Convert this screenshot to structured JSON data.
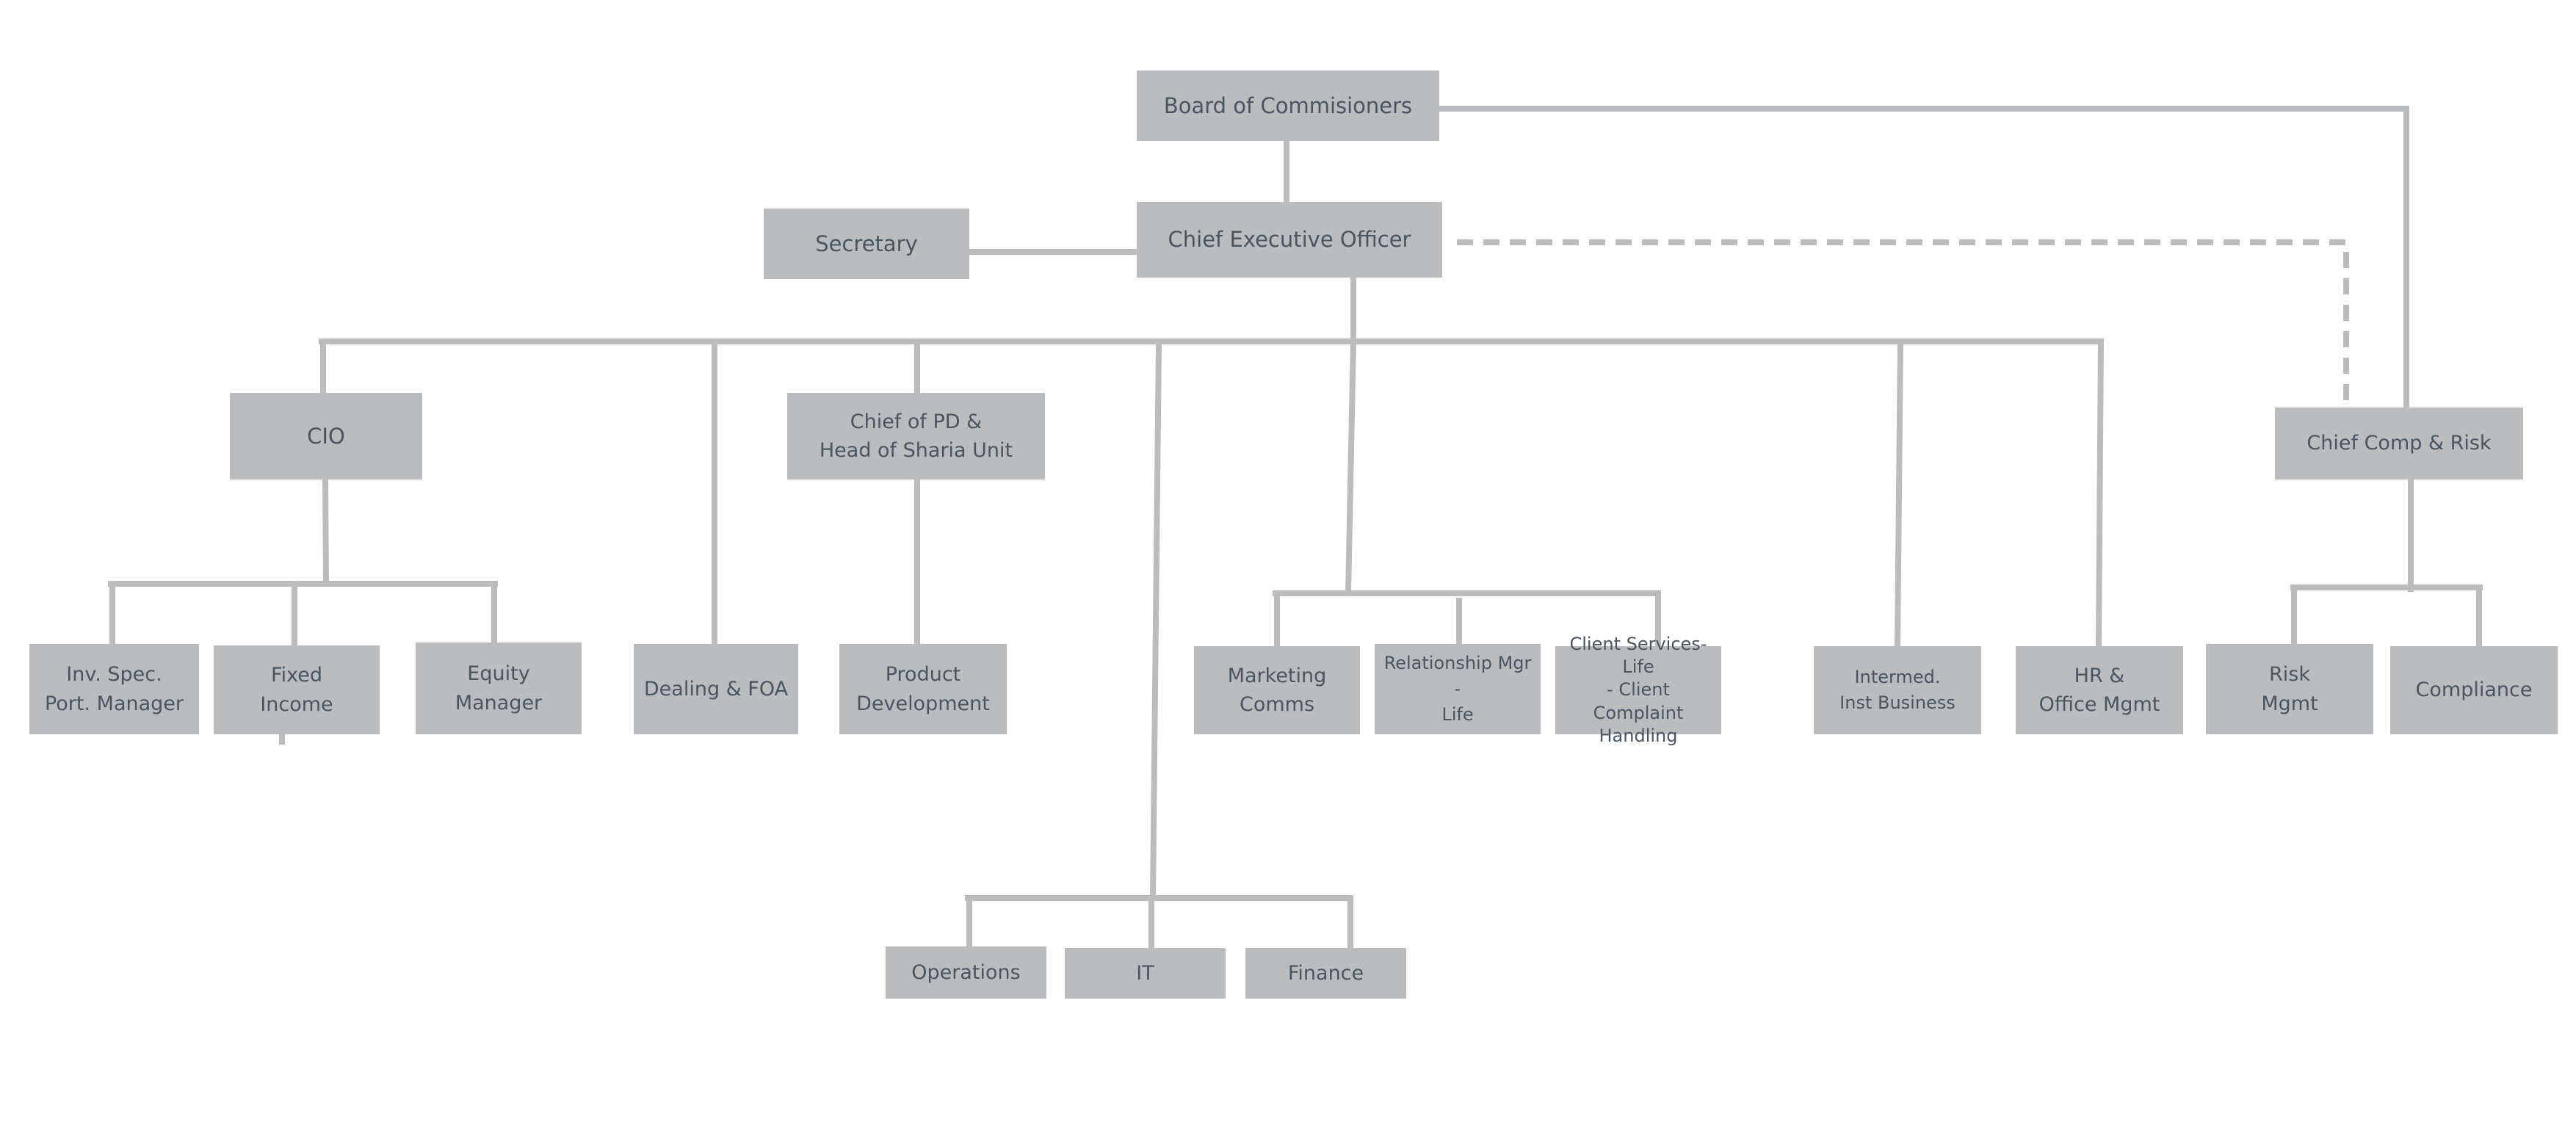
{
  "chart": {
    "type": "org-chart",
    "colors": {
      "box_fill": "#bbbcbe",
      "text": "#4a5560",
      "connector": "#bbbcbe",
      "background": "#ffffff"
    },
    "nodes": {
      "board": {
        "label": "Board of Commisioners"
      },
      "ceo": {
        "label": "Chief Executive Officer"
      },
      "secretary": {
        "label": "Secretary"
      },
      "cio": {
        "label": "CIO"
      },
      "chief_pd": {
        "label": "Chief of PD &\nHead of Sharia Unit"
      },
      "chief_comp_risk": {
        "label": "Chief Comp & Risk"
      },
      "inv_spec": {
        "label": "Inv. Spec.\nPort. Manager"
      },
      "fixed_income": {
        "label": "Fixed\nIncome"
      },
      "equity": {
        "label": "Equity\nManager"
      },
      "dealing": {
        "label": "Dealing & FOA"
      },
      "product_dev": {
        "label": "Product\nDevelopment"
      },
      "marketing": {
        "label": "Marketing\nComms"
      },
      "relationship": {
        "label": "Relationship Mgr -\nLife"
      },
      "client_services": {
        "label": "Client Services-Life\n- Client Complaint\nHandling"
      },
      "intermed": {
        "label": "Intermed.\nInst Business"
      },
      "hr": {
        "label": "HR &\nOffice Mgmt"
      },
      "risk": {
        "label": "Risk\nMgmt"
      },
      "compliance": {
        "label": "Compliance"
      },
      "operations": {
        "label": "Operations"
      },
      "it": {
        "label": "IT"
      },
      "finance": {
        "label": "Finance"
      }
    },
    "edges": [
      {
        "from": "board",
        "to": "ceo",
        "style": "solid"
      },
      {
        "from": "board",
        "to": "chief_comp_risk",
        "style": "solid"
      },
      {
        "from": "ceo",
        "to": "chief_comp_risk",
        "style": "dashed"
      },
      {
        "from": "ceo",
        "to": "secretary",
        "style": "solid"
      },
      {
        "from": "ceo",
        "to": "cio",
        "style": "solid"
      },
      {
        "from": "ceo",
        "to": "dealing",
        "style": "solid"
      },
      {
        "from": "ceo",
        "to": "chief_pd",
        "style": "solid"
      },
      {
        "from": "ceo",
        "to": "operations",
        "style": "solid"
      },
      {
        "from": "ceo",
        "to": "it",
        "style": "solid"
      },
      {
        "from": "ceo",
        "to": "finance",
        "style": "solid"
      },
      {
        "from": "ceo",
        "to": "marketing",
        "style": "solid"
      },
      {
        "from": "ceo",
        "to": "relationship",
        "style": "solid"
      },
      {
        "from": "ceo",
        "to": "client_services",
        "style": "solid"
      },
      {
        "from": "ceo",
        "to": "intermed",
        "style": "solid"
      },
      {
        "from": "ceo",
        "to": "hr",
        "style": "solid"
      },
      {
        "from": "cio",
        "to": "inv_spec",
        "style": "solid"
      },
      {
        "from": "cio",
        "to": "fixed_income",
        "style": "solid"
      },
      {
        "from": "cio",
        "to": "equity",
        "style": "solid"
      },
      {
        "from": "chief_pd",
        "to": "product_dev",
        "style": "solid"
      },
      {
        "from": "chief_comp_risk",
        "to": "risk",
        "style": "solid"
      },
      {
        "from": "chief_comp_risk",
        "to": "compliance",
        "style": "solid"
      }
    ]
  }
}
